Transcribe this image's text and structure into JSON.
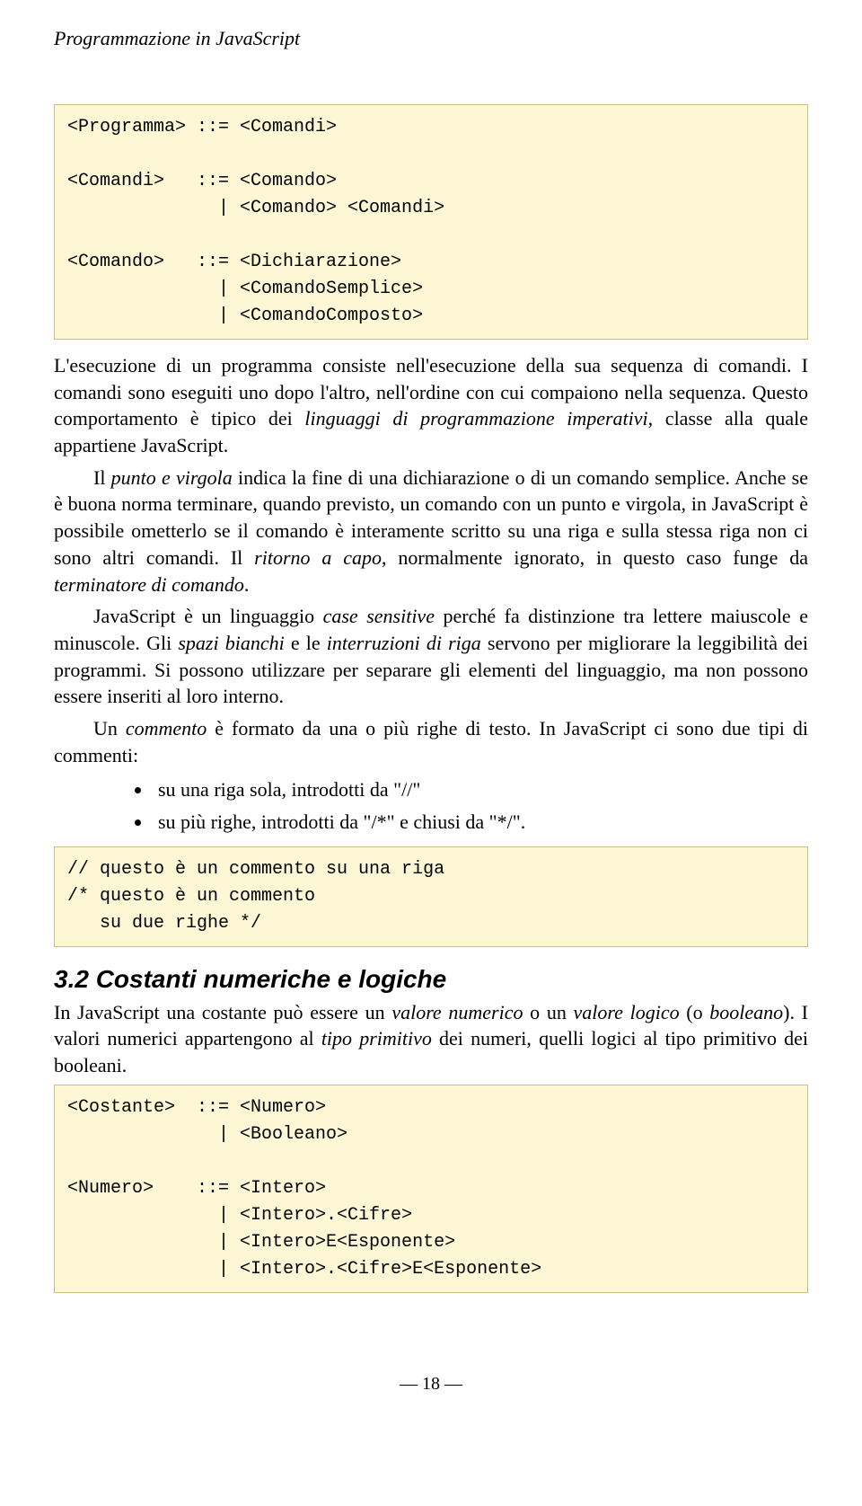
{
  "header": {
    "running_title": "Programmazione in JavaScript"
  },
  "code1": "<Programma> ::= <Comandi>\n\n<Comandi>   ::= <Comando>\n              | <Comando> <Comandi>\n\n<Comando>   ::= <Dichiarazione>\n              | <ComandoSemplice>\n              | <ComandoComposto>",
  "para1": {
    "t1": "L'esecuzione di un programma consiste nell'esecuzione della sua sequenza di comandi. I comandi sono eseguiti uno dopo l'altro, nell'ordine con cui compaiono nella sequenza. Questo comportamento è tipico dei ",
    "i1": "linguaggi di programmazione imperativi",
    "t2": ", classe alla quale appartiene JavaScript."
  },
  "para2": {
    "t1": "Il ",
    "i1": "punto e virgola",
    "t2": " indica la fine di una dichiarazione o di un comando semplice. Anche se è buona norma terminare, quando previsto, un comando con un punto e virgola, in JavaScript è possibile ometterlo se il comando è interamente scritto su una riga e sulla stessa riga non ci sono altri comandi. Il ",
    "i2": "ritorno a capo",
    "t3": ", normalmente ignorato, in questo caso funge da ",
    "i3": "terminatore di comando",
    "t4": "."
  },
  "para3": {
    "t1": "JavaScript è un linguaggio ",
    "i1": "case sensitive",
    "t2": " perché fa distinzione tra lettere maiuscole e minuscole. Gli ",
    "i2": "spazi bianchi",
    "t3": " e le ",
    "i3": "interruzioni di riga",
    "t4": " servono per migliorare la leggibilità dei programmi. Si possono utilizzare per separare gli elementi del linguaggio, ma non possono essere inseriti al loro interno."
  },
  "para4": {
    "t1": "Un ",
    "i1": "commento",
    "t2": " è formato da una o più righe di testo. In JavaScript ci sono due tipi di commenti:"
  },
  "bullets": {
    "b1": "su una riga sola, introdotti da \"//\"",
    "b2": "su più righe, introdotti da \"/*\" e chiusi da \"*/\"."
  },
  "code2": "// questo è un commento su una riga\n/* questo è un commento\n   su due righe */",
  "section32": "3.2  Costanti numeriche e logiche",
  "para5": {
    "t1": "In JavaScript una costante può essere un ",
    "i1": "valore numerico",
    "t2": " o un ",
    "i2": "valore logico",
    "t3": " (o ",
    "i3": "booleano",
    "t4": "). I valori numerici appartengono al ",
    "i4": "tipo primitivo",
    "t5": " dei numeri, quelli logici al tipo primitivo dei booleani."
  },
  "code3": "<Costante>  ::= <Numero>\n              | <Booleano>\n\n<Numero>    ::= <Intero>\n              | <Intero>.<Cifre>\n              | <Intero>E<Esponente>\n              | <Intero>.<Cifre>E<Esponente>",
  "footer": {
    "pagenum": "—  18  —"
  }
}
